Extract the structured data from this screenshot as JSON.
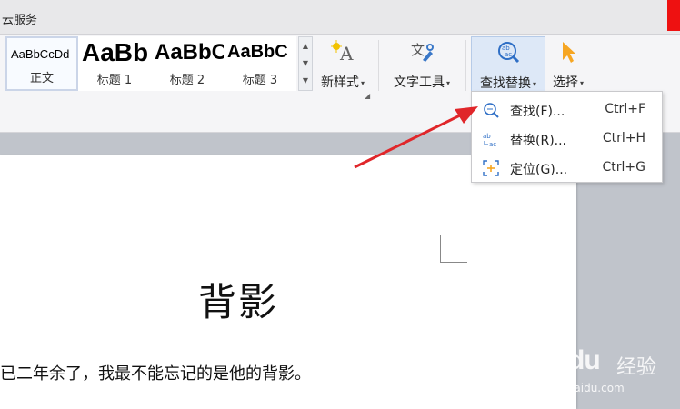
{
  "tabbar": {
    "partial_tab_text": "云服务"
  },
  "ribbon": {
    "styles": [
      {
        "preview": "AaBbCcDd",
        "name": "正文"
      },
      {
        "preview": "AaBb",
        "name": "标题 1"
      },
      {
        "preview": "AaBbC",
        "name": "标题 2"
      },
      {
        "preview": "AaBbC",
        "name": "标题 3"
      }
    ],
    "new_style_label": "新样式",
    "text_tools_label": "文字工具",
    "find_replace_label": "查找替换",
    "select_label": "选择",
    "caret": "▾"
  },
  "menu": {
    "items": [
      {
        "label": "查找(F)...",
        "shortcut": "Ctrl+F",
        "icon": "find-icon"
      },
      {
        "label": "替换(R)...",
        "shortcut": "Ctrl+H",
        "icon": "replace-icon"
      },
      {
        "label": "定位(G)...",
        "shortcut": "Ctrl+G",
        "icon": "goto-icon"
      }
    ]
  },
  "document": {
    "title": "背影",
    "line1": "已二年余了，我最不能忘记的是他的背影。"
  },
  "watermark": {
    "logo": "Bai du",
    "site": "经验",
    "url": "jingyan.baidu.com"
  },
  "colors": {
    "accent_blue": "#2f6fc6",
    "selected_bg": "#dde8f7",
    "arrow_red": "#e0262a"
  }
}
